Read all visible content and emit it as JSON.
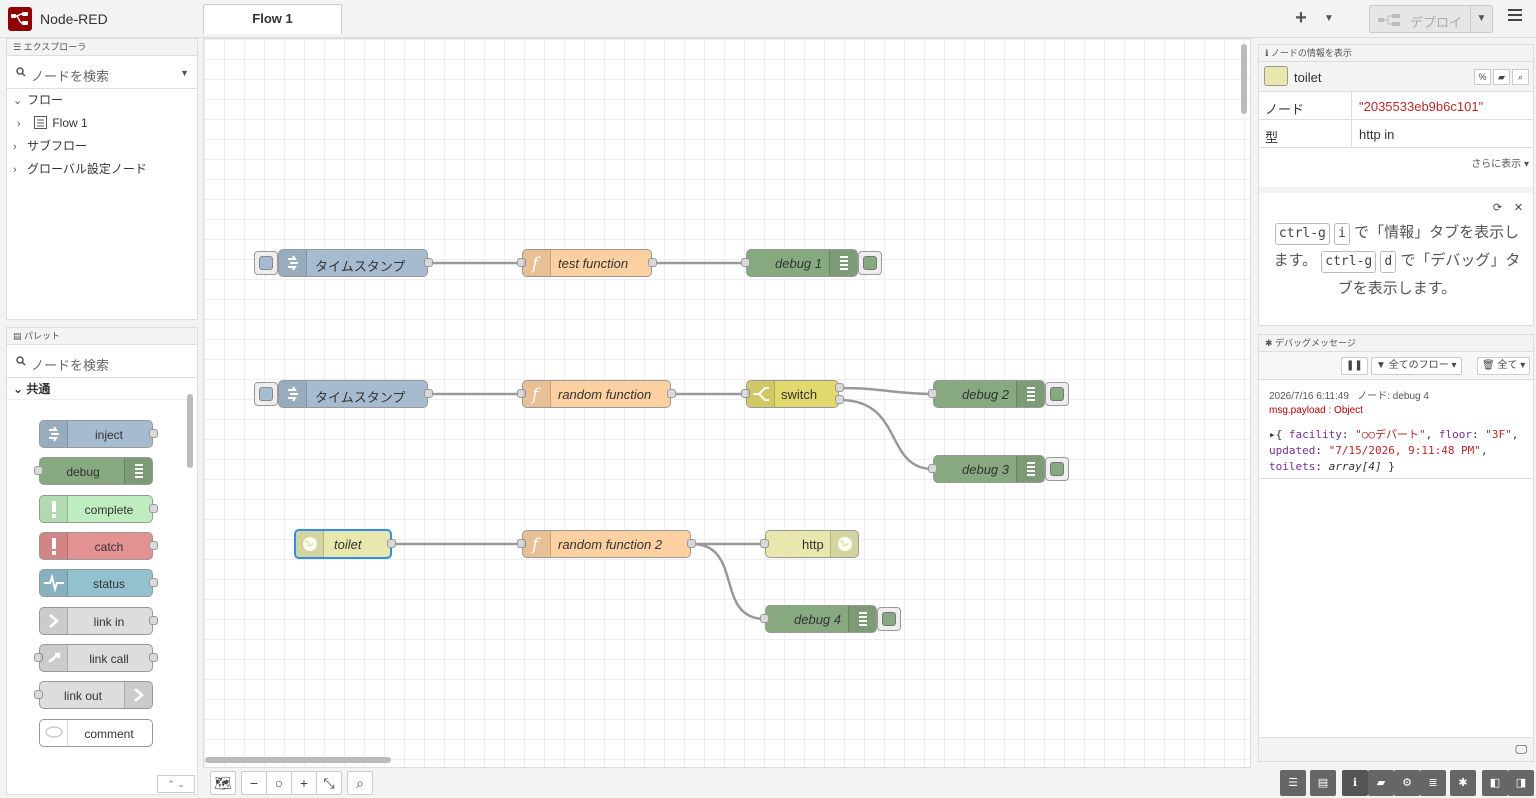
{
  "header": {
    "app_title": "Node-RED",
    "flow_tab": "Flow 1",
    "add_label": "+",
    "deploy_label": "デプロイ"
  },
  "explorer": {
    "title": "エクスプローラ",
    "search_placeholder": "ノードを検索",
    "tree": {
      "flows": "フロー",
      "flow1": "Flow 1",
      "subflows": "サブフロー",
      "global": "グローバル設定ノード"
    }
  },
  "palette": {
    "title": "パレット",
    "search_placeholder": "ノードを検索",
    "category": "共通",
    "nodes": {
      "inject": "inject",
      "debug": "debug",
      "complete": "complete",
      "catch": "catch",
      "status": "status",
      "link_in": "link in",
      "link_call": "link call",
      "link_out": "link out",
      "comment": "comment"
    }
  },
  "flow": {
    "ts1": "タイムスタンプ",
    "test_function": "test function",
    "debug1": "debug 1",
    "ts2": "タイムスタンプ",
    "random_function": "random function",
    "switch": "switch",
    "debug2": "debug 2",
    "debug3": "debug 3",
    "toilet": "toilet",
    "random_function2": "random function 2",
    "http": "http",
    "debug4": "debug 4"
  },
  "info": {
    "title": "ノードの情報を表示",
    "node_name": "toilet",
    "prop_node_key": "ノード",
    "prop_node_val": "\"2035533eb9b6c101\"",
    "prop_type_key": "型",
    "prop_type_val": "http in",
    "more": "さらに表示",
    "tip_part1": "で「情報」タブを表示します。",
    "tip_part2": "で「デバッグ」タブを表示します。",
    "kbd_ctrlg": "ctrl-g",
    "kbd_i": "i",
    "kbd_d": "d"
  },
  "debug": {
    "title": "デバッグメッセージ",
    "filter": "全てのフロー",
    "clear": "全て",
    "timestamp": "2026/7/16 6:11:49",
    "node_label": "ノード: debug 4",
    "topic": "msg.payload : Object",
    "msg_open": "{ ",
    "k_facility": "facility",
    "v_facility": "\"○○デパート\"",
    "k_floor": "floor",
    "v_floor": "\"3F\"",
    "k_updated": "updated",
    "v_updated": "\"7/15/2026, 9:11:48 PM\"",
    "k_toilets": "toilets",
    "v_toilets": "array[4]",
    "msg_close": " }"
  },
  "colors": {
    "inject": "#a6bbcf",
    "function": "#fdd0a2",
    "debug": "#87a980",
    "switch": "#e2d96e",
    "http": "#e7e7ae",
    "complete": "#c0edc0",
    "catch": "#e49191",
    "status": "#94c1d0",
    "link": "#dddddd"
  }
}
